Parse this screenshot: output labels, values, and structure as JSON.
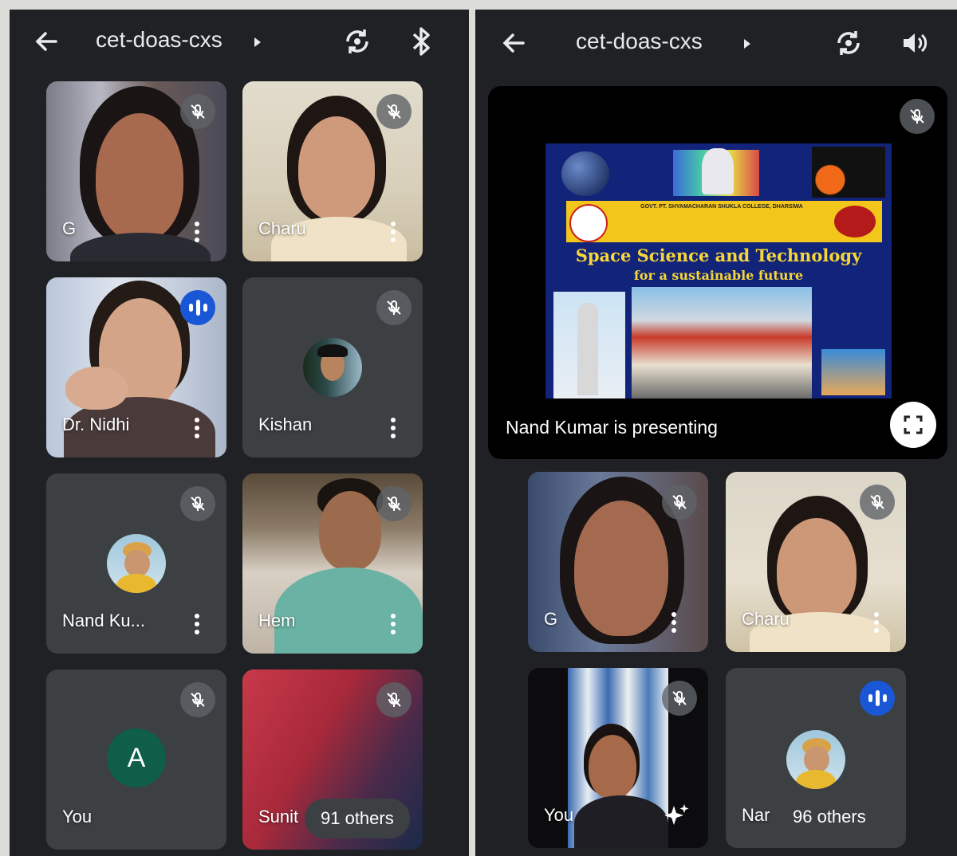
{
  "left_screen": {
    "meeting_code": "cet-doas-cxs",
    "tiles": [
      {
        "name": "G"
      },
      {
        "name": "Charu"
      },
      {
        "name": "Dr. Nidhi"
      },
      {
        "name": "Kishan"
      },
      {
        "name": "Nand Ku..."
      },
      {
        "name": "Hem"
      },
      {
        "name": "You",
        "avatar_letter": "A"
      },
      {
        "name": "Sunit"
      }
    ],
    "others_label": "91 others"
  },
  "right_screen": {
    "meeting_code": "cet-doas-cxs",
    "presentation": {
      "caption": "Nand Kumar is presenting",
      "slide_title": "Space Science and Technology",
      "slide_subtitle": "for a sustainable future",
      "slide_banner": "GOVT. PT. SHYAMACHARAN SHUKLA COLLEGE, DHARSIWA"
    },
    "tiles": [
      {
        "name": "G"
      },
      {
        "name": "Charu"
      },
      {
        "name": "You"
      },
      {
        "name": "Nar"
      }
    ],
    "others_label": "96 others"
  },
  "icons": [
    "back-arrow-icon",
    "play-arrow-icon",
    "switch-camera-icon",
    "bluetooth-icon",
    "speaker-icon",
    "mic-off-icon",
    "more-vert-icon",
    "speaking-indicator-icon",
    "fullscreen-icon",
    "sparkle-effects-icon"
  ],
  "colors": {
    "background": "#202124",
    "tile": "#3c4043",
    "speaking": "#1a57d6",
    "avatar_A": "#0f5e4a"
  }
}
